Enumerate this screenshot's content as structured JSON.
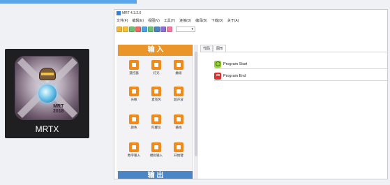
{
  "app_tile": {
    "name": "MRTX",
    "badge_line1": "MRT",
    "badge_line2": "2018"
  },
  "window": {
    "title": "MRT 4.3.2.0",
    "menu": [
      "文件(F)",
      "编辑(E)",
      "视图(V)",
      "工具(T)",
      "连接(D)",
      "编译(B)",
      "下载(D)",
      "关于(A)"
    ],
    "toolbar_colors": [
      "#f2b63a",
      "#f2c23a",
      "#6ac26f",
      "#ee6a6a",
      "#4aa3e0",
      "#6ac26f",
      "#4a86c6",
      "#8d6fd1",
      "#f07aa0"
    ],
    "tabs": [
      "代码",
      "图形"
    ],
    "palette": {
      "header": "输 入",
      "footer": "输 出",
      "blocks": [
        "遥控器",
        "灯光",
        "触碰",
        "光敏",
        "麦克风",
        "超声波",
        "颜色",
        "陀螺仪",
        "循线",
        "数字输入",
        "模拟输入",
        "开始键"
      ]
    },
    "program_nodes": [
      "Program Start",
      "Program End"
    ]
  }
}
